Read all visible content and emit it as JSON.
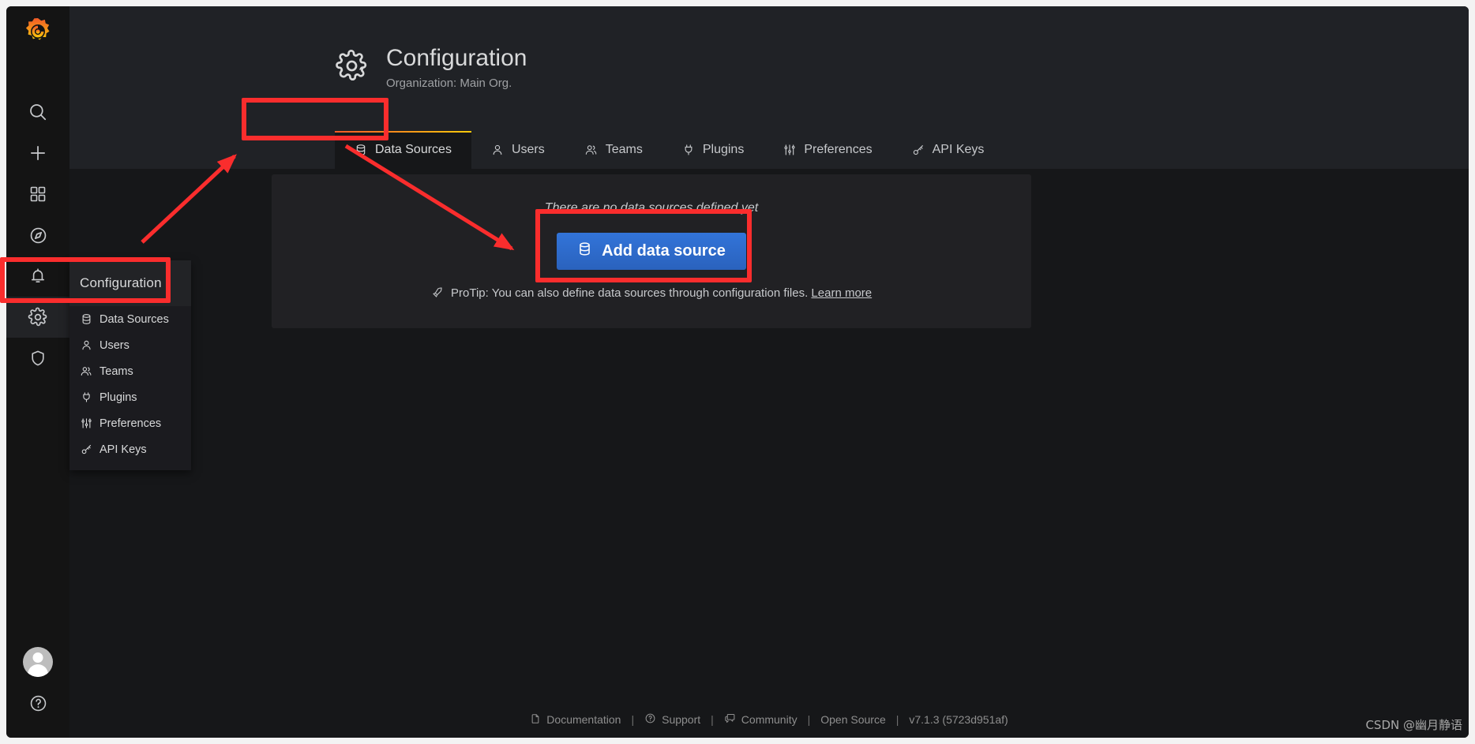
{
  "app": {
    "brand_icon": "grafana-logo-icon"
  },
  "sidebar": {
    "items": [
      {
        "id": "search",
        "icon": "search-icon",
        "label": "Search"
      },
      {
        "id": "create",
        "icon": "plus-icon",
        "label": "Create"
      },
      {
        "id": "dashboards",
        "icon": "apps-icon",
        "label": "Dashboards"
      },
      {
        "id": "explore",
        "icon": "compass-icon",
        "label": "Explore"
      },
      {
        "id": "alerting",
        "icon": "bell-icon",
        "label": "Alerting"
      },
      {
        "id": "configuration",
        "icon": "gear-icon",
        "label": "Configuration"
      },
      {
        "id": "server-admin",
        "icon": "shield-icon",
        "label": "Server Admin"
      }
    ],
    "bottom_items": [
      {
        "id": "profile",
        "icon": "avatar-icon",
        "label": "Profile"
      },
      {
        "id": "help",
        "icon": "question-circle-icon",
        "label": "Help"
      }
    ]
  },
  "flyout": {
    "header": {
      "label": "Configuration",
      "icon": "gear-icon"
    },
    "items": [
      {
        "label": "Data Sources",
        "icon": "database-icon"
      },
      {
        "label": "Users",
        "icon": "user-icon"
      },
      {
        "label": "Teams",
        "icon": "users-alt-icon"
      },
      {
        "label": "Plugins",
        "icon": "plug-icon"
      },
      {
        "label": "Preferences",
        "icon": "sliders-icon"
      },
      {
        "label": "API Keys",
        "icon": "key-icon"
      }
    ]
  },
  "header": {
    "icon": "gear-icon",
    "title": "Configuration",
    "subtitle": "Organization: Main Org."
  },
  "tabs": [
    {
      "label": "Data Sources",
      "icon": "database-icon",
      "active": true
    },
    {
      "label": "Users",
      "icon": "user-icon",
      "active": false
    },
    {
      "label": "Teams",
      "icon": "users-alt-icon",
      "active": false
    },
    {
      "label": "Plugins",
      "icon": "plug-icon",
      "active": false
    },
    {
      "label": "Preferences",
      "icon": "sliders-icon",
      "active": false
    },
    {
      "label": "API Keys",
      "icon": "key-icon",
      "active": false
    }
  ],
  "empty_state": {
    "title": "There are no data sources defined yet",
    "button_label": "Add data source",
    "button_icon": "database-icon",
    "protip_icon": "rocket-icon",
    "protip_text": "ProTip: You can also define data sources through configuration files.",
    "protip_link": "Learn more"
  },
  "footer": {
    "links": [
      {
        "label": "Documentation",
        "icon": "document-icon"
      },
      {
        "label": "Support",
        "icon": "question-circle-icon"
      },
      {
        "label": "Community",
        "icon": "comments-icon"
      },
      {
        "label": "Open Source",
        "icon": ""
      }
    ],
    "separator": "|",
    "version": "v7.1.3 (5723d951af)"
  },
  "watermark": {
    "text": "CSDN @幽月静语"
  },
  "colors": {
    "accent_start": "#f05a28",
    "accent_end": "#fbca0a",
    "primary_button": "#3274d9",
    "annotation": "#fa2d2d",
    "panel_bg": "#212124",
    "header_bg": "#202226",
    "body_bg": "#161719",
    "sidemenu_bg": "#141414"
  }
}
